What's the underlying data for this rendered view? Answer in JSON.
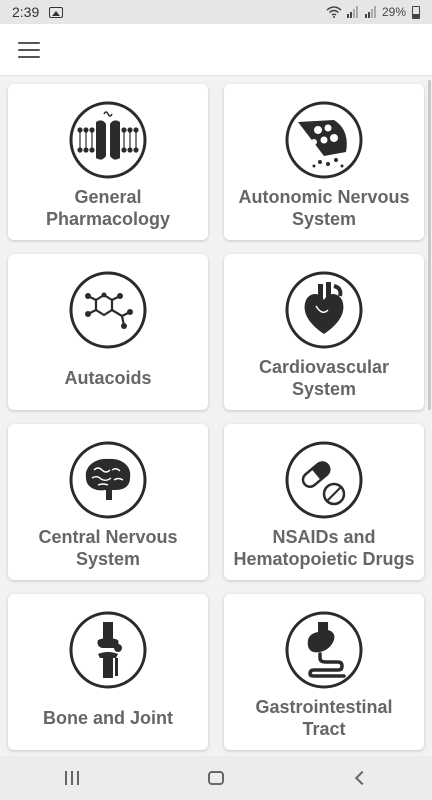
{
  "status_bar": {
    "time": "2:39",
    "battery": "29%",
    "icons": [
      "gallery-icon",
      "wifi-icon",
      "signal-icon",
      "battery-icon"
    ]
  },
  "app_bar": {
    "menu_icon": "hamburger-menu-icon"
  },
  "categories": [
    {
      "label": "General\nPharmacology",
      "icon": "cell-membrane-channel-icon"
    },
    {
      "label": "Autonomic Nervous\nSystem",
      "icon": "synapse-icon"
    },
    {
      "label": "Autacoids",
      "icon": "molecule-icon"
    },
    {
      "label": "Cardiovascular\nSystem",
      "icon": "heart-icon"
    },
    {
      "label": "Central Nervous\nSystem",
      "icon": "brain-icon"
    },
    {
      "label": "NSAIDs and\nHematopoietic Drugs",
      "icon": "pills-icon"
    },
    {
      "label": "Bone and Joint",
      "icon": "knee-joint-icon"
    },
    {
      "label": "Gastrointestinal\nTract",
      "icon": "stomach-icon"
    }
  ],
  "nav_bar": {
    "buttons": [
      "recents-icon",
      "home-icon",
      "back-icon"
    ]
  },
  "colors": {
    "card_bg": "#ffffff",
    "page_bg": "#f2f2f2",
    "label": "#666666",
    "icon": "#333333"
  }
}
